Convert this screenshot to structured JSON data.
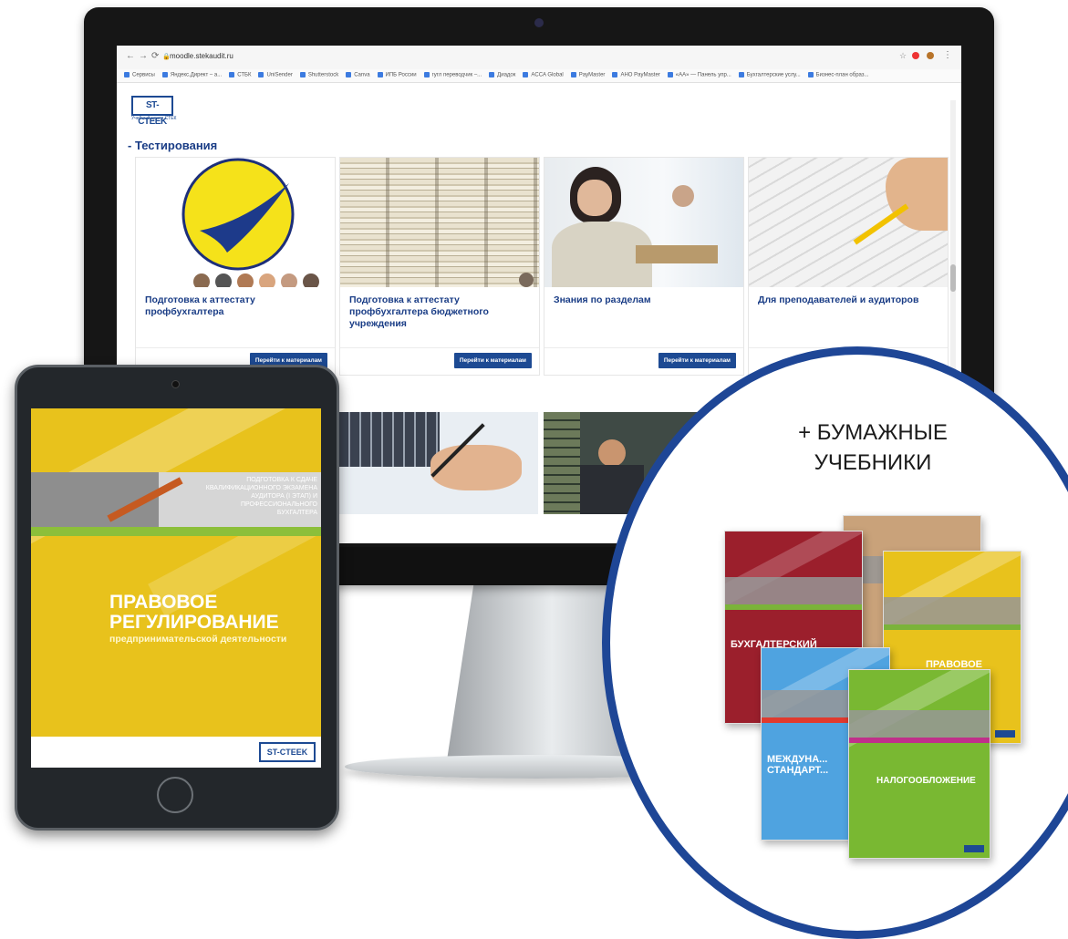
{
  "browser": {
    "url": "moodle.stekaudit.ru",
    "nav": {
      "back": "←",
      "forward": "→",
      "reload": "⟳"
    },
    "bookmarks": [
      "Сервисы",
      "Яндекс.Директ – а...",
      "СТБК",
      "UniSender",
      "Shutterstock",
      "Canva",
      "ИПБ России",
      "гугл переводчик –...",
      "Диадок",
      "ACCA Global",
      "PayMaster",
      "АНО PayMaster",
      "«АА» — Панель упр...",
      "Бухгалтерские услу...",
      "Бизнес-план образ..."
    ]
  },
  "site": {
    "logo": "ST-CTEEK",
    "logo_sub": "Учебный центр СТЕК",
    "section_title": "- Тестирования",
    "cards": [
      {
        "title": "Подготовка к аттестату профбухгалтера",
        "button": "Перейти к материалам",
        "image": "yellow-logo-circle"
      },
      {
        "title": "Подготовка к аттестату профбухгалтера бюджетного учреждения",
        "button": "Перейти к материалам",
        "image": "stack-of-papers-photo"
      },
      {
        "title": "Знания по разделам",
        "button": "Перейти к материалам",
        "image": "student-at-desk-photo"
      },
      {
        "title": "Для преподавателей и аудиторов",
        "button": "",
        "image": "answer-sheet-photo"
      }
    ]
  },
  "tablet_book": {
    "series": "ПОДГОТОВКА К СДАЧЕ КВАЛИФИКАЦИОННОГО ЭКЗАМЕНА АУДИТОРА (I ЭТАП) И ПРОФЕССИОНАЛЬНОГО БУХГАЛТЕРА",
    "title_line1": "ПРАВОВОЕ",
    "title_line2": "РЕГУЛИРОВАНИЕ",
    "subtitle": "предпринимательской деятельности",
    "logo": "ST-CTEEK"
  },
  "circle": {
    "heading_line1": "+ БУМАЖНЫЕ",
    "heading_line2": "УЧЕБНИКИ",
    "books": [
      {
        "label": "БУХГАЛТЕРСКИЙ",
        "color": "#9b1f2c"
      },
      {
        "label": "",
        "color": "#c9a27a"
      },
      {
        "label": "ПРАВОВОЕ",
        "color": "#e8c21c"
      },
      {
        "label": "МЕЖДУНА... СТАНДАРТ...",
        "color": "#4fa3e0"
      },
      {
        "label": "НАЛОГООБЛОЖЕНИЕ",
        "color": "#79b832"
      }
    ]
  },
  "colors": {
    "brand_blue": "#1d4a93",
    "circle_border": "#1e4696",
    "title_blue": "#1a3d86"
  }
}
